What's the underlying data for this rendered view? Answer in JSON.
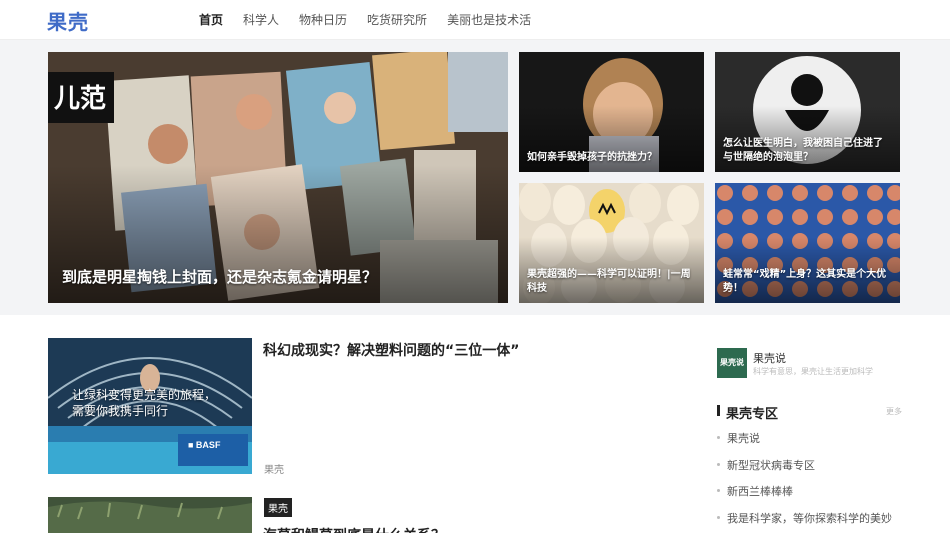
{
  "header": {
    "logo": "果壳",
    "nav": [
      "首页",
      "科学人",
      "物种日历",
      "吃货研究所",
      "美丽也是技术活"
    ]
  },
  "hero": {
    "main": {
      "badge": "儿范",
      "caption": "到底是明星掏钱上封面，还是杂志氪金请明星？"
    },
    "tiles": [
      {
        "caption": "如何亲手毁掉孩子的抗挫力？"
      },
      {
        "caption": "怎么让医生明白，我被困自己住进了与世隔绝的泡泡里？"
      },
      {
        "caption": "果壳超强的——科学可以证明！|一周科技"
      },
      {
        "caption": "蛙常常“戏精”上身？这其实是个大优势！"
      }
    ]
  },
  "articles": [
    {
      "title": "科幻成现实？解决塑料问题的“三位一体”",
      "tag": "果壳",
      "thumb_text": "让绿科变得更完美的旅程，需要你我携手同行",
      "thumb_brand": "■ BASF"
    },
    {
      "title": "海草和鳗草到底是什么关系？",
      "tag": "果壳"
    }
  ],
  "sidebar": {
    "account": {
      "avatar": "果壳说",
      "name": "果壳说",
      "desc": "科学有意思，果壳让生活更加科学"
    },
    "zone": {
      "title": "果壳专区",
      "more": "更多",
      "items": [
        "果壳说",
        "新型冠状病毒专区",
        "新西兰棒棒棒",
        "我是科学家，等你探索科学的美妙"
      ]
    }
  }
}
